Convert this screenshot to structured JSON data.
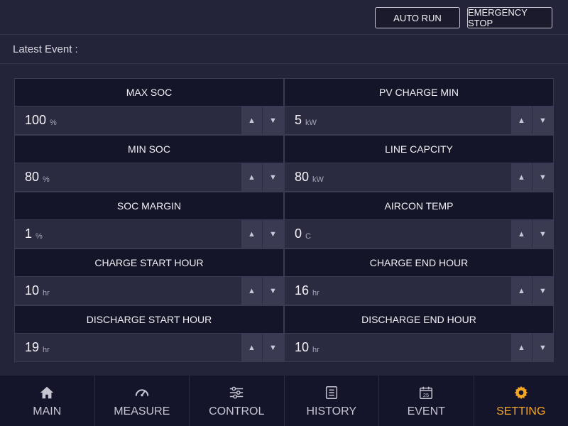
{
  "header": {
    "auto_run_label": "AUTO RUN",
    "emergency_stop_label": "EMERGENCY STOP"
  },
  "event": {
    "label": "Latest Event :",
    "value": ""
  },
  "settings": [
    {
      "title": "MAX SOC",
      "value": "100",
      "unit": "%"
    },
    {
      "title": "PV CHARGE MIN",
      "value": "5",
      "unit": "kW"
    },
    {
      "title": "MIN SOC",
      "value": "80",
      "unit": "%"
    },
    {
      "title": "LINE CAPCITY",
      "value": "80",
      "unit": "kW"
    },
    {
      "title": "SOC MARGIN",
      "value": "1",
      "unit": "%"
    },
    {
      "title": "AIRCON TEMP",
      "value": "0",
      "unit": "C"
    },
    {
      "title": "CHARGE START HOUR",
      "value": "10",
      "unit": "hr"
    },
    {
      "title": "CHARGE END HOUR",
      "value": "16",
      "unit": "hr"
    },
    {
      "title": "DISCHARGE START HOUR",
      "value": "19",
      "unit": "hr"
    },
    {
      "title": "DISCHARGE END HOUR",
      "value": "10",
      "unit": "hr"
    }
  ],
  "stepper": {
    "up_glyph": "▲",
    "down_glyph": "▼"
  },
  "nav": {
    "items": [
      {
        "label": "MAIN",
        "icon": "home-icon"
      },
      {
        "label": "MEASURE",
        "icon": "gauge-icon"
      },
      {
        "label": "CONTROL",
        "icon": "sliders-icon"
      },
      {
        "label": "HISTORY",
        "icon": "list-icon"
      },
      {
        "label": "EVENT",
        "icon": "calendar-icon",
        "icon_text": "25"
      },
      {
        "label": "SETTING",
        "icon": "gear-icon"
      }
    ],
    "active_index": 5,
    "active_color": "#f5a623"
  }
}
